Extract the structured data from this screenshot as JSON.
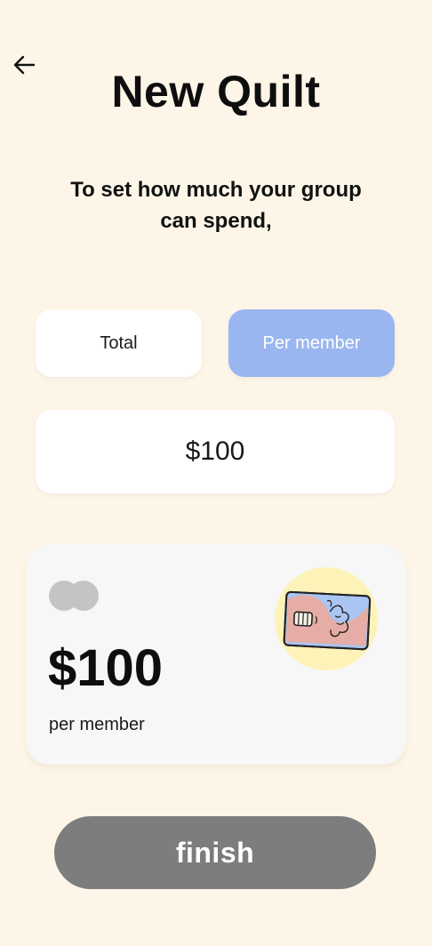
{
  "header": {
    "back_icon": "arrow-left-icon",
    "title": "New Quilt"
  },
  "prompt": {
    "text": "To set how much your group can spend,"
  },
  "toggle": {
    "total_label": "Total",
    "per_member_label": "Per member",
    "selected": "Per member",
    "selected_color": "#99b6f0"
  },
  "amount_field": {
    "value": "$100"
  },
  "card": {
    "logo_icon": "card-brand-circles-icon",
    "amount": "$100",
    "caption": "per member",
    "illustration_icon": "card-illustration-icon"
  },
  "actions": {
    "finish_label": "finish"
  },
  "colors": {
    "background": "#fdf6e8",
    "finish_button": "#7d7d7d",
    "illustration_circle": "#fdf3b8"
  }
}
